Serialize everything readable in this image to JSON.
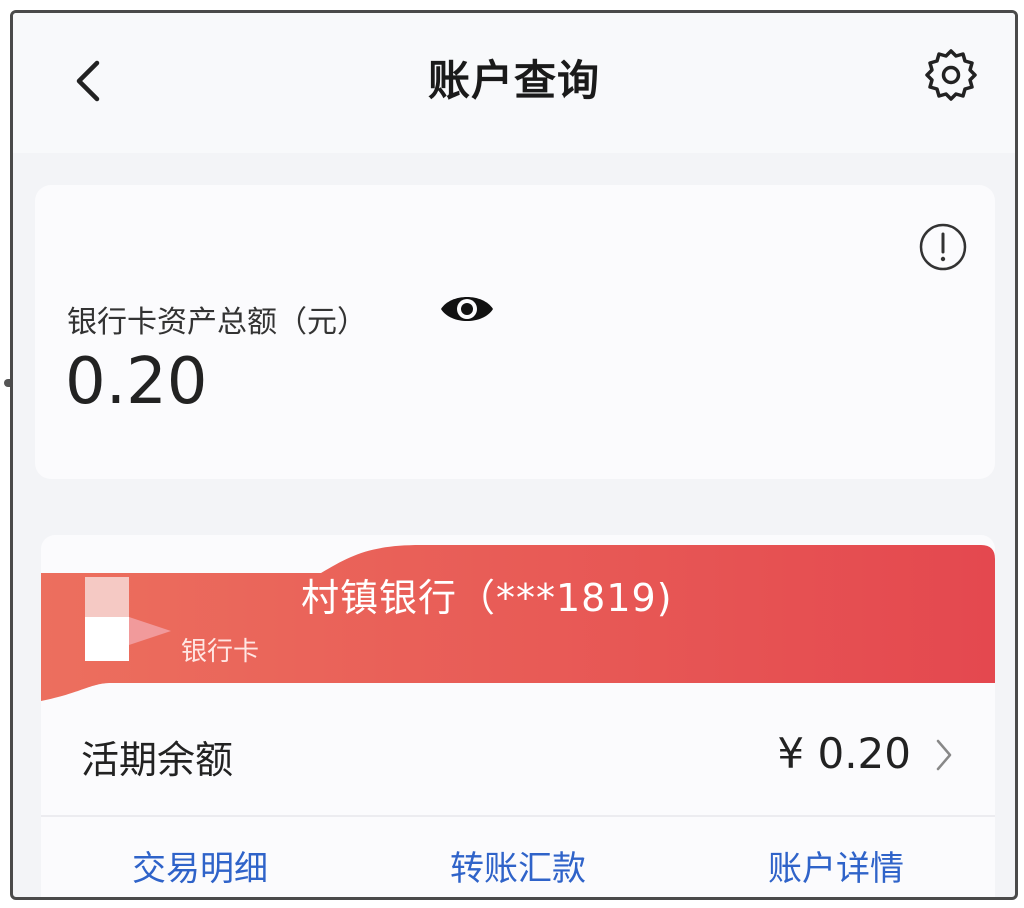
{
  "header": {
    "title": "账户查询",
    "back_icon": "chevron-left-icon",
    "settings_icon": "gear-icon"
  },
  "asset_summary": {
    "label": "银行卡资产总额（元）",
    "value": "0.20",
    "visibility_icon": "eye-icon",
    "info_icon": "info-icon"
  },
  "bank_card": {
    "bank_name": "村镇银行（***1819)",
    "card_type": "银行卡",
    "balance_label": "活期余额",
    "balance_value": "¥ 0.20",
    "accent_color": "#e9505a",
    "actions": [
      {
        "label": "交易明细"
      },
      {
        "label": "转账汇款"
      },
      {
        "label": "账户详情"
      }
    ],
    "action_color": "#2f63c9"
  }
}
